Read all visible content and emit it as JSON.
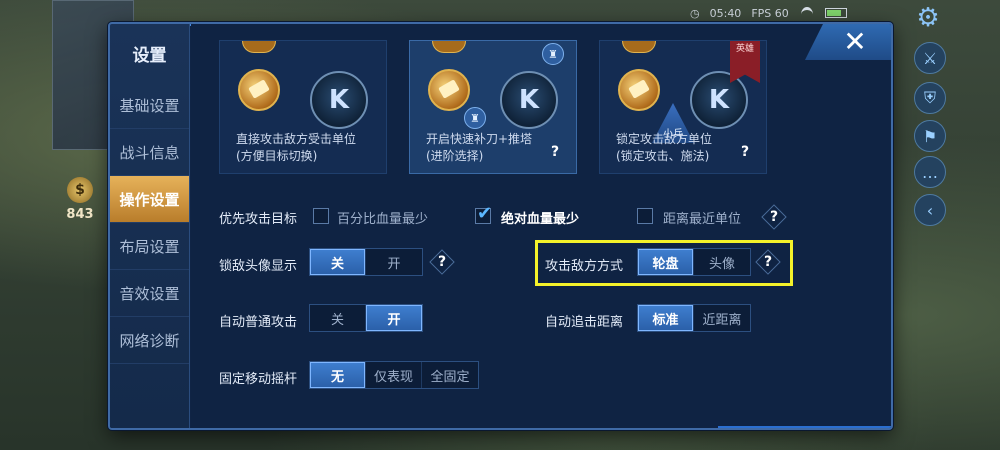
{
  "status": {
    "time": "05:40",
    "fps": "FPS 60"
  },
  "gold": {
    "amount": "843",
    "symbol": "$"
  },
  "modal": {
    "title": "设置",
    "close_label": "✕"
  },
  "sidebar": {
    "items": [
      {
        "label": "基础设置",
        "active": false
      },
      {
        "label": "战斗信息",
        "active": false
      },
      {
        "label": "操作设置",
        "active": true
      },
      {
        "label": "布局设置",
        "active": false
      },
      {
        "label": "音效设置",
        "active": false
      },
      {
        "label": "网络诊断",
        "active": false
      }
    ]
  },
  "cards": [
    {
      "line1": "直接攻击敌方受击单位",
      "line2": "(方便目标切换)",
      "selected": false
    },
    {
      "line1": "开启快速补刀+推塔",
      "line2": "(进阶选择)",
      "selected": true
    },
    {
      "line1": "锁定攻击敌方单位",
      "line2": "(锁定攻击、施法)",
      "selected": false
    }
  ],
  "card_extras": {
    "hero_flag": "英雄",
    "minion_tag": "小兵",
    "skill_glyph": "K"
  },
  "priority": {
    "label": "优先攻击目标",
    "options": [
      {
        "label": "百分比血量最少",
        "checked": false
      },
      {
        "label": "绝对血量最少",
        "checked": true
      },
      {
        "label": "距离最近单位",
        "checked": false
      }
    ]
  },
  "lock_avatar": {
    "label": "锁敌头像显示",
    "options": [
      "关",
      "开"
    ],
    "selected": "关"
  },
  "attack_mode": {
    "label": "攻击敌方方式",
    "options": [
      "轮盘",
      "头像"
    ],
    "selected": "轮盘"
  },
  "auto_attack": {
    "label": "自动普通攻击",
    "options": [
      "关",
      "开"
    ],
    "selected": "开"
  },
  "auto_chase": {
    "label": "自动追击距离",
    "options": [
      "标准",
      "近距离"
    ],
    "selected": "标准"
  },
  "joystick": {
    "label": "固定移动摇杆",
    "options": [
      "无",
      "仅表现",
      "全固定"
    ],
    "selected": "无"
  },
  "help": "?",
  "colors": {
    "accent": "#3f7fd0",
    "active_tab": "#e6b25a",
    "highlight": "#f4f22a",
    "modal_bg": "#102445"
  }
}
